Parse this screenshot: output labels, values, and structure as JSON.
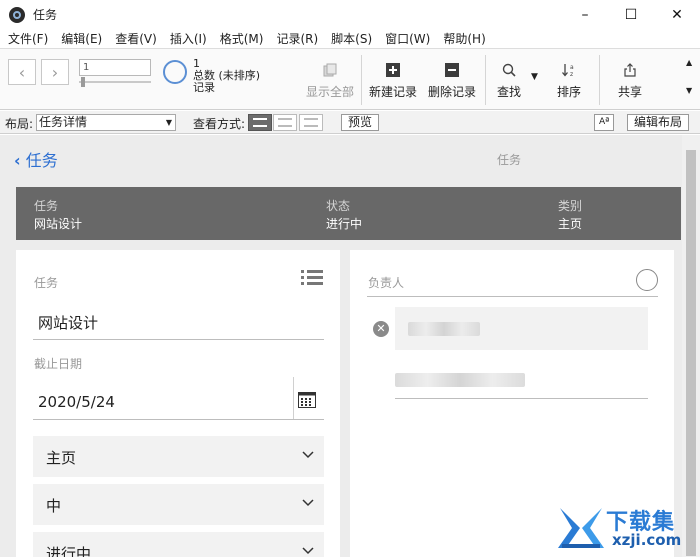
{
  "window": {
    "title": "任务",
    "minimize": "–",
    "maximize": "☐",
    "close": "✕"
  },
  "menu": [
    "文件(F)",
    "编辑(E)",
    "查看(V)",
    "插入(I)",
    "格式(M)",
    "记录(R)",
    "脚本(S)",
    "窗口(W)",
    "帮助(H)"
  ],
  "toolbar": {
    "record_value": "1",
    "record_count": "1",
    "total_label": "总数 (未排序)",
    "records_label": "记录",
    "show_all": "显示全部",
    "new_record": "新建记录",
    "delete_record": "删除记录",
    "find": "查找",
    "sort": "排序",
    "share": "共享"
  },
  "layoutbar": {
    "layout_label": "布局:",
    "layout_value": "任务详情",
    "view_label": "查看方式:",
    "preview": "预览",
    "aa": "Aª",
    "edit_layout": "编辑布局"
  },
  "nav": {
    "back_label": "任务",
    "page_title": "任务"
  },
  "header": {
    "task_label": "任务",
    "task_value": "网站设计",
    "status_label": "状态",
    "status_value": "进行中",
    "category_label": "类别",
    "category_value": "主页"
  },
  "left_card": {
    "task_label": "任务",
    "task_value": "网站设计",
    "due_label": "截止日期",
    "due_value": "2020/5/24",
    "dropdowns": [
      "主页",
      "中",
      "进行中"
    ]
  },
  "right_card": {
    "owner_label": "负责人"
  },
  "watermark": {
    "text": "下载集",
    "url": "xzji.com"
  },
  "colors": {
    "accent": "#2d6fd1",
    "header_band": "#686868"
  }
}
